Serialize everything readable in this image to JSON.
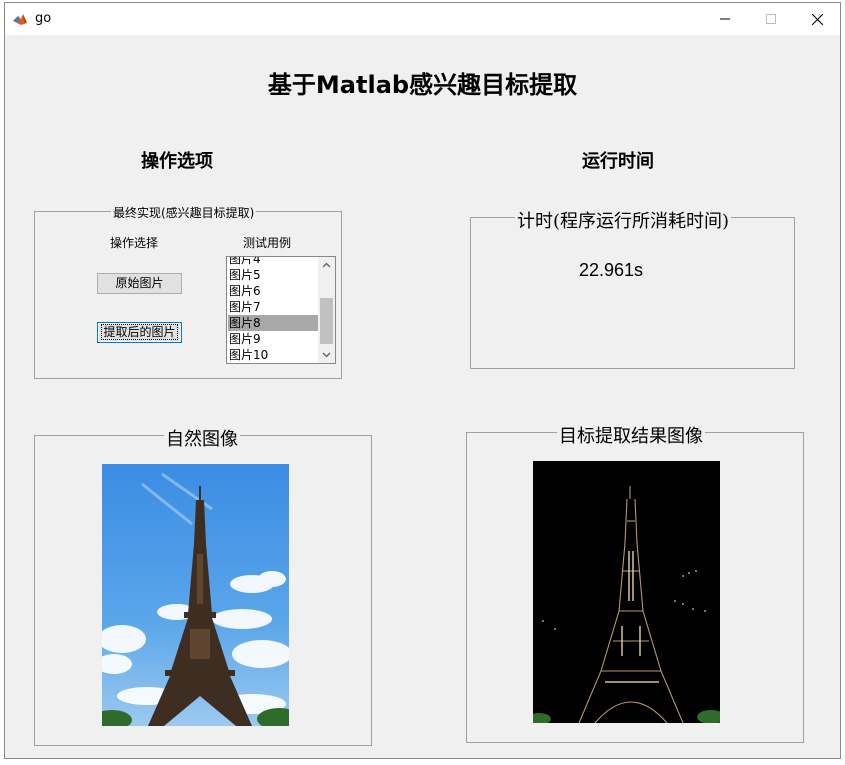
{
  "window": {
    "title": "go"
  },
  "header": {
    "title": "基于Matlab感兴趣目标提取"
  },
  "sections": {
    "options_title": "操作选项",
    "runtime_title": "运行时间"
  },
  "options_panel": {
    "legend": "最终实现(感兴趣目标提取)",
    "operation_label": "操作选择",
    "testcase_label": "测试用例",
    "original_button": "原始图片",
    "extracted_button": "提取后的图片",
    "list_items": [
      "图片4",
      "图片5",
      "图片6",
      "图片7",
      "图片8",
      "图片9",
      "图片10"
    ],
    "selected_item": "图片8"
  },
  "timer_panel": {
    "legend": "计时(程序运行所消耗时间)",
    "value": "22.961s"
  },
  "natural_panel": {
    "legend": "自然图像"
  },
  "result_panel": {
    "legend": "目标提取结果图像"
  },
  "colors": {
    "window_bg": "#f0f0f0",
    "selection": "#a8a8a8",
    "focus_border": "#0078d7",
    "sky_blue": "#3d8fe0",
    "result_bg": "#000000"
  },
  "icons": {
    "app": "matlab-icon",
    "minimize": "minimize-icon",
    "maximize": "maximize-icon",
    "close": "close-icon",
    "scroll_up": "chevron-up-icon",
    "scroll_down": "chevron-down-icon"
  }
}
